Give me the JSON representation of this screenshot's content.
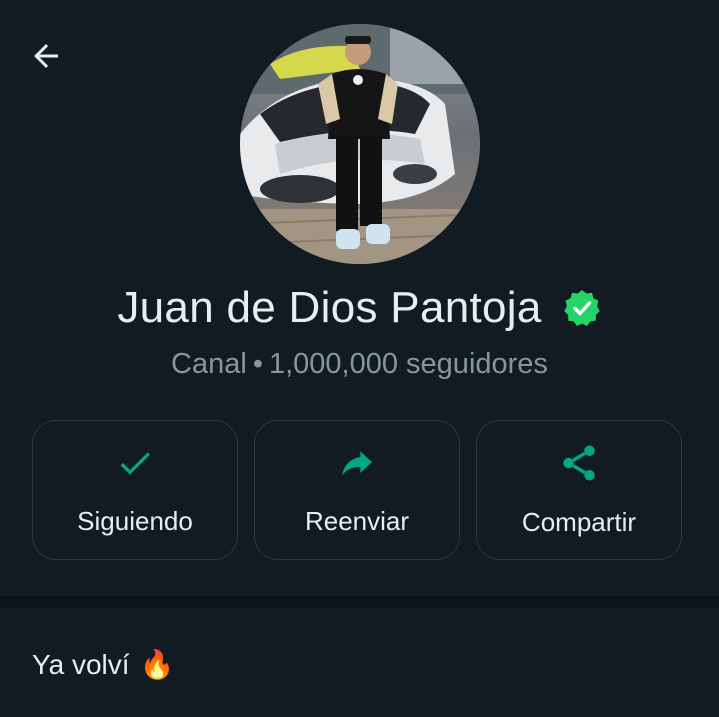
{
  "header": {
    "back_icon": "arrow-left-icon"
  },
  "profile": {
    "name": "Juan de Dios Pantoja",
    "verified_icon": "verified-badge-icon",
    "type_label": "Canal",
    "separator": "•",
    "followers": "1,000,000 seguidores"
  },
  "actions": [
    {
      "label": "Siguiendo",
      "icon": "check-icon"
    },
    {
      "label": "Reenviar",
      "icon": "forward-icon"
    },
    {
      "label": "Compartir",
      "icon": "share-icon"
    }
  ],
  "description": {
    "text": "Ya volví",
    "emoji": "🔥"
  },
  "colors": {
    "background": "#111b21",
    "accent": "#00a884",
    "verified": "#25d366",
    "text_primary": "#e9edef",
    "text_secondary": "#8696a0",
    "border": "#2a3942"
  }
}
